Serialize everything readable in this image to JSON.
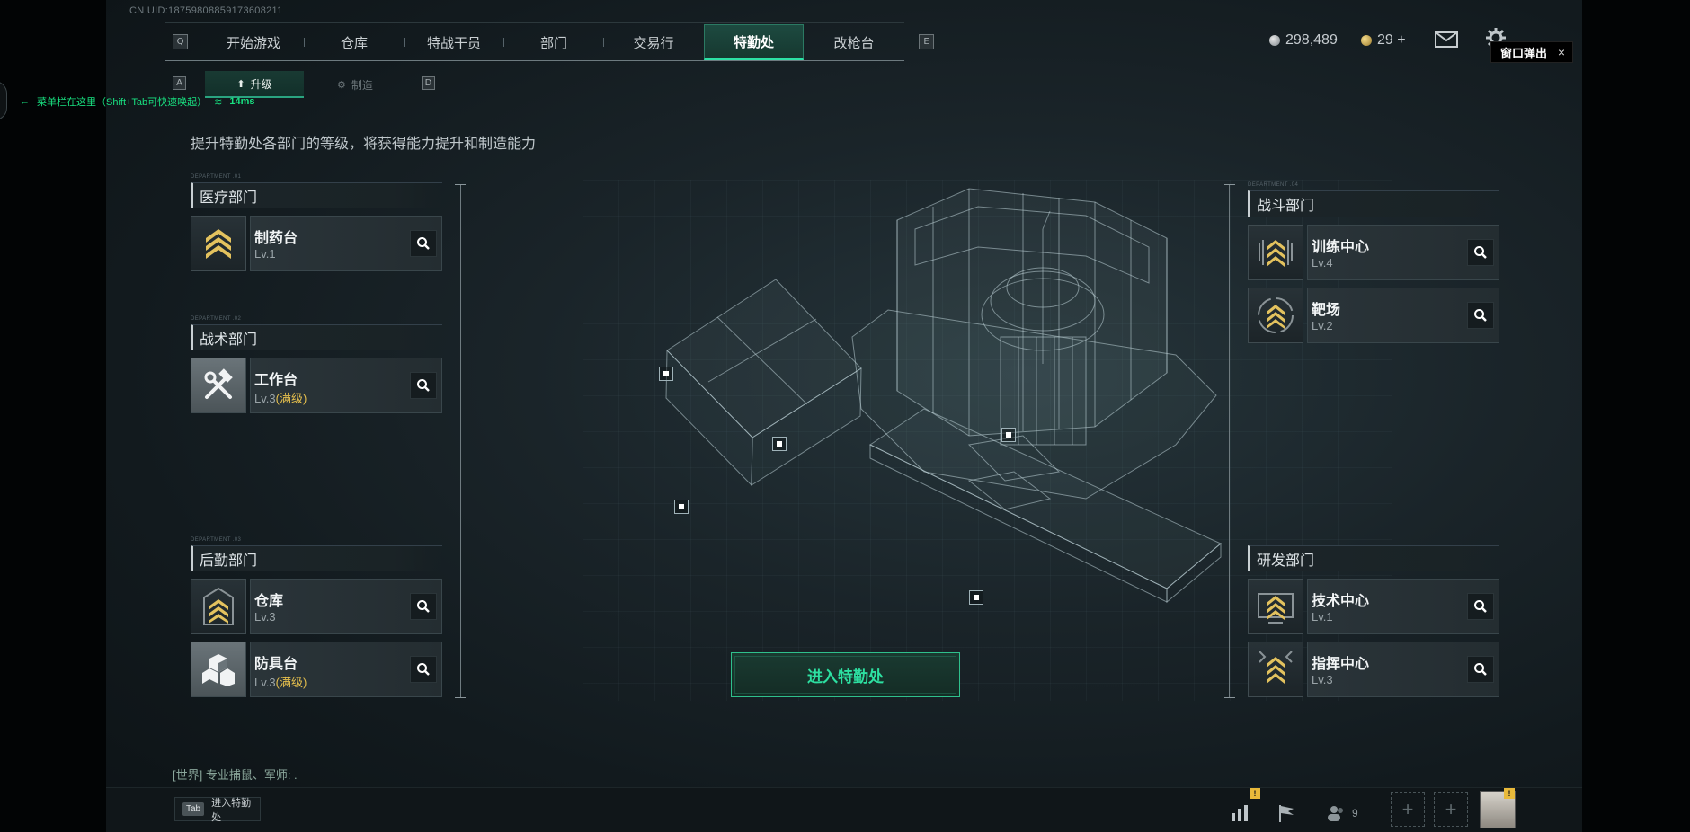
{
  "uid": "CN UID:187598088591736082​11",
  "nav": {
    "left_key": "Q",
    "right_key": "E",
    "tabs": [
      "开始游戏",
      "仓库",
      "特战干员",
      "部门",
      "交易行",
      "特勤处",
      "改枪台"
    ],
    "active_tab": "特勤处"
  },
  "currency": {
    "silver": "298,489",
    "gold": "29 +"
  },
  "popup": {
    "label": "窗口弹出",
    "close": "×"
  },
  "subtabs": {
    "left_key": "A",
    "right_key": "D",
    "upgrade": "升级",
    "craft": "制造"
  },
  "notice": {
    "text": "菜单栏在这里（Shift+Tab可快速唤起）",
    "ping": "14ms"
  },
  "description": "提升特勤处各部门的等级，将获得能力提升和制造能力",
  "departments": {
    "medical": {
      "tag": "DEPARTMENT .01",
      "title": "医疗部门",
      "items": [
        {
          "name": "制药台",
          "level": "Lv.1"
        }
      ]
    },
    "tactical": {
      "tag": "DEPARTMENT .02",
      "title": "战术部门",
      "items": [
        {
          "name": "工作台",
          "level": "Lv.3",
          "max": "(满级)"
        }
      ]
    },
    "logistics": {
      "tag": "DEPARTMENT .03",
      "title": "后勤部门",
      "items": [
        {
          "name": "仓库",
          "level": "Lv.3"
        },
        {
          "name": "防具台",
          "level": "Lv.3",
          "max": "(满级)"
        }
      ]
    },
    "combat": {
      "tag": "DEPARTMENT .04",
      "title": "战斗部门",
      "items": [
        {
          "name": "训练中心",
          "level": "Lv.4"
        },
        {
          "name": "靶场",
          "level": "Lv.2"
        }
      ]
    },
    "research": {
      "title": "研发部门",
      "items": [
        {
          "name": "技术中心",
          "level": "Lv.1"
        },
        {
          "name": "指挥中心",
          "level": "Lv.3"
        }
      ]
    }
  },
  "enter_button": "进入特勤处",
  "chat": "[世界] 专业捕鼠、军师: .",
  "bottom": {
    "tab_key": "Tab",
    "tab_label": "进入特勤处",
    "friends_count": "9",
    "badge": "!"
  },
  "colors": {
    "accent": "#2de0a5",
    "max_level": "#e5bf4d",
    "chevron": "#e3c25e"
  }
}
